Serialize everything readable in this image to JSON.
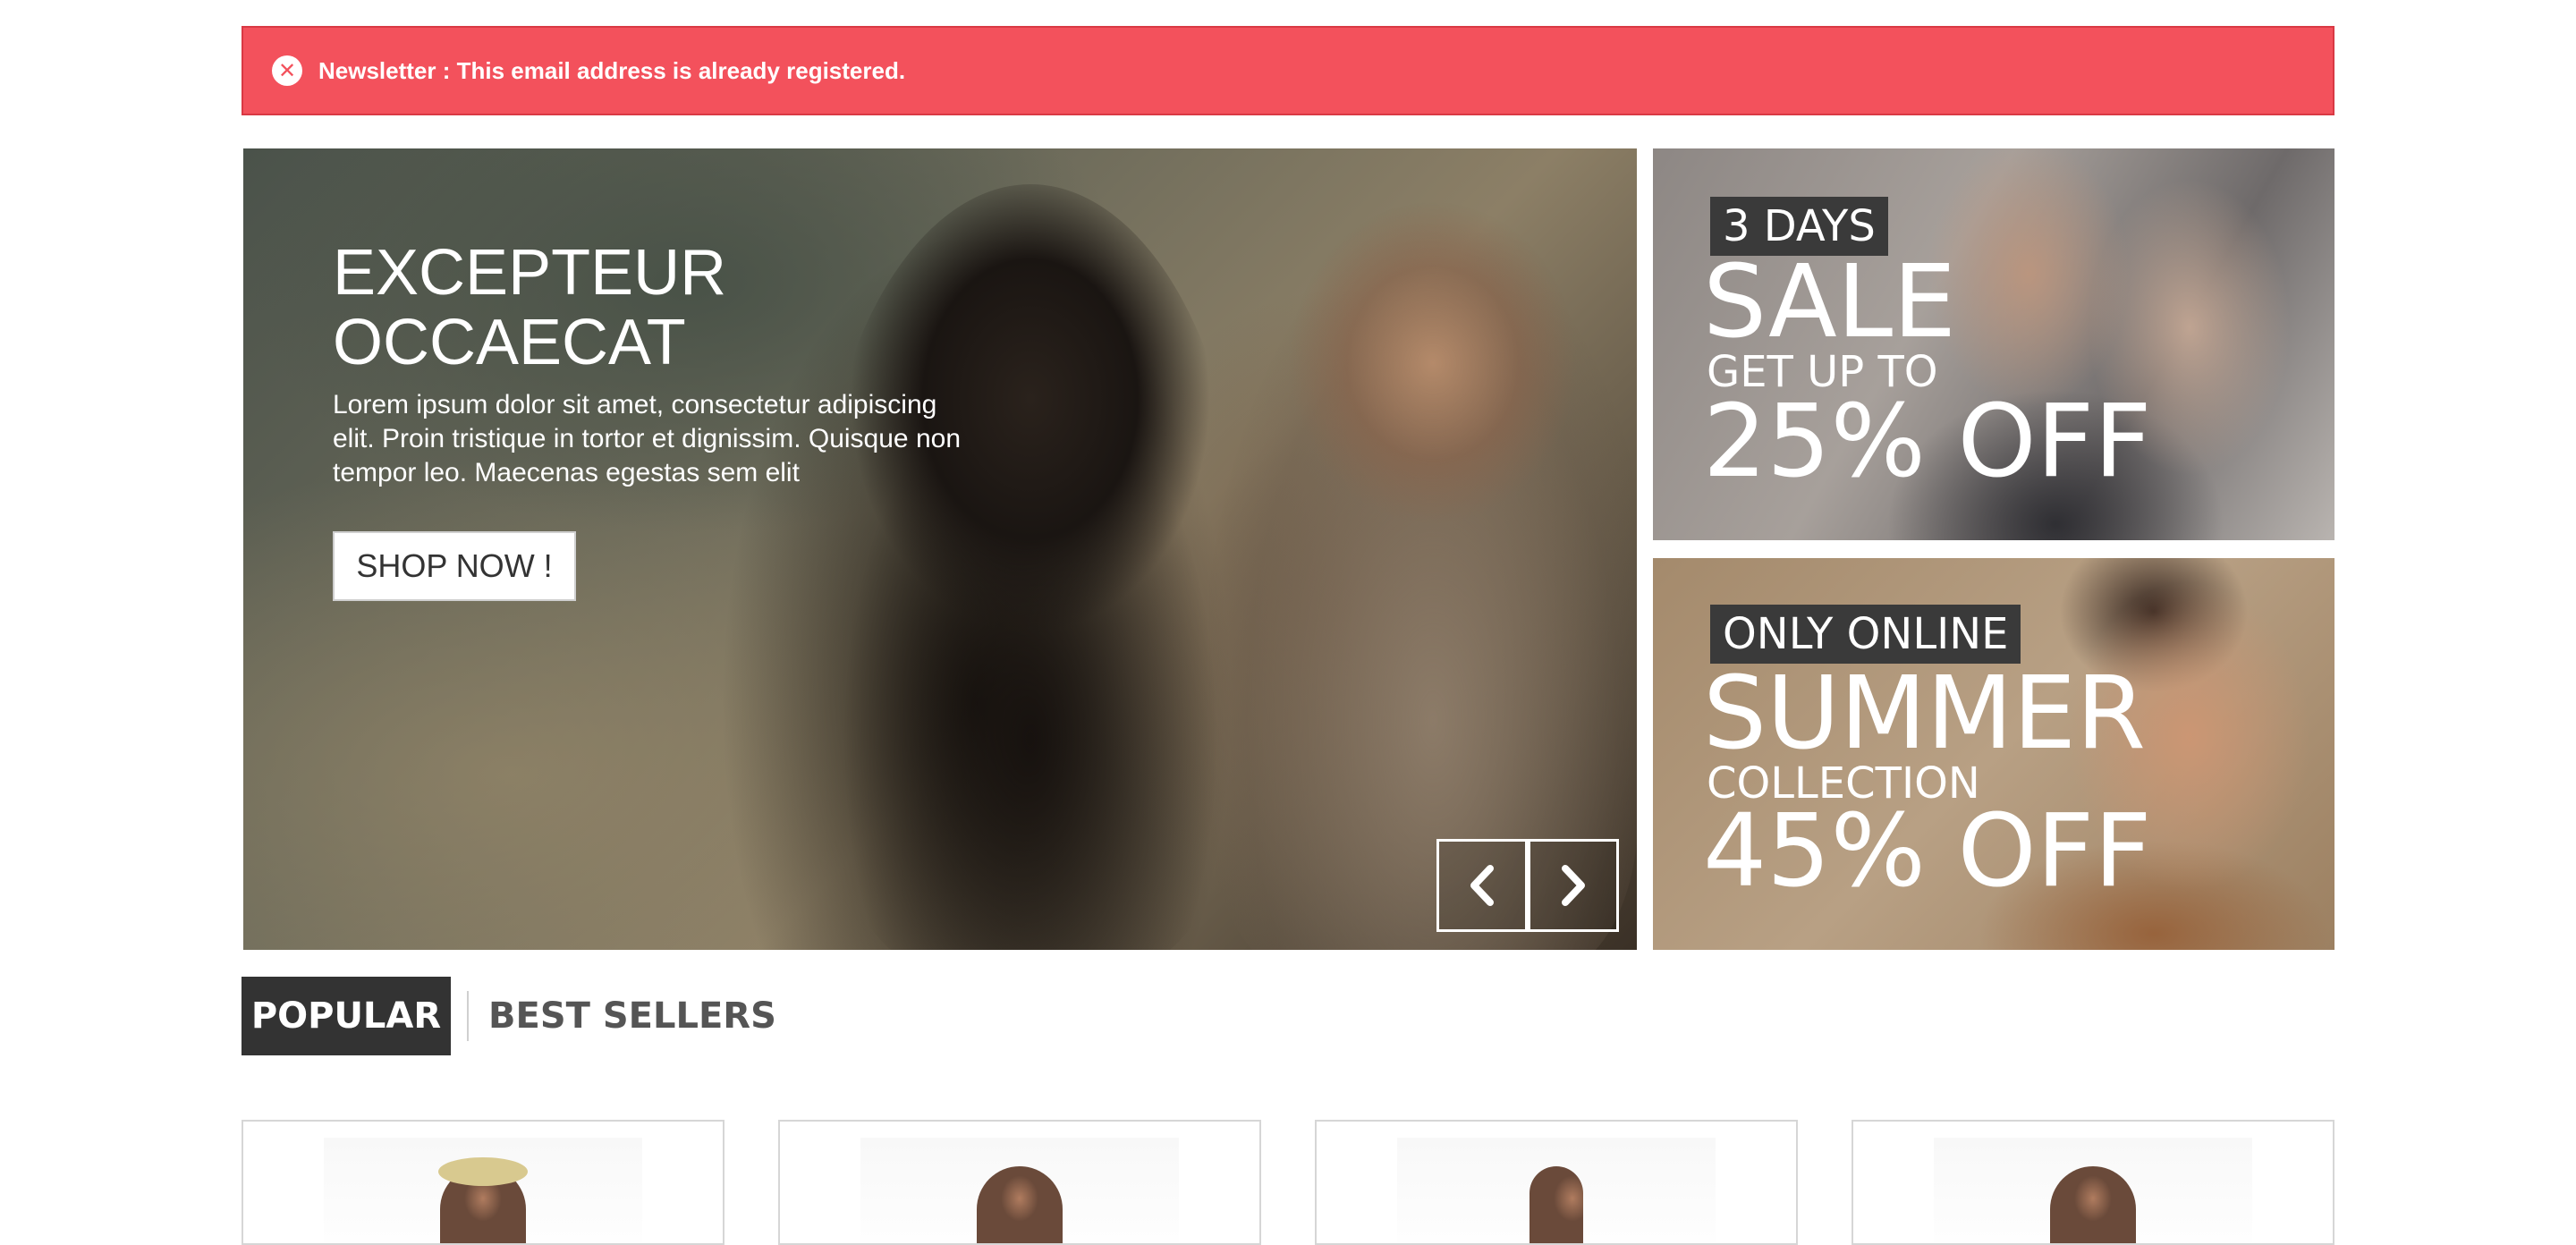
{
  "alert": {
    "icon": "close-circle-icon",
    "message": "Newsletter : This email address is already registered.",
    "color": "#f3515c"
  },
  "slider": {
    "title_line1": "EXCEPTEUR",
    "title_line2": "OCCAECAT",
    "text": "Lorem ipsum dolor sit amet, consectetur adipiscing elit. Proin tristique in tortor et dignissim. Quisque non tempor leo. Maecenas egestas sem elit",
    "button_label": "SHOP NOW !",
    "prev_icon": "chevron-left-icon",
    "next_icon": "chevron-right-icon"
  },
  "banners": [
    {
      "tag": "3 DAYS",
      "headline": "SALE",
      "subline": "GET UP TO",
      "offer": "25% OFF"
    },
    {
      "tag": "ONLY ONLINE",
      "headline": "SUMMER",
      "subline": "COLLECTION",
      "offer": "45% OFF"
    }
  ],
  "tabs": [
    {
      "label": "POPULAR",
      "active": true
    },
    {
      "label": "BEST SELLERS",
      "active": false
    }
  ],
  "products": [
    {
      "image": "product-image"
    },
    {
      "image": "product-image"
    },
    {
      "image": "product-image"
    },
    {
      "image": "product-image"
    }
  ]
}
